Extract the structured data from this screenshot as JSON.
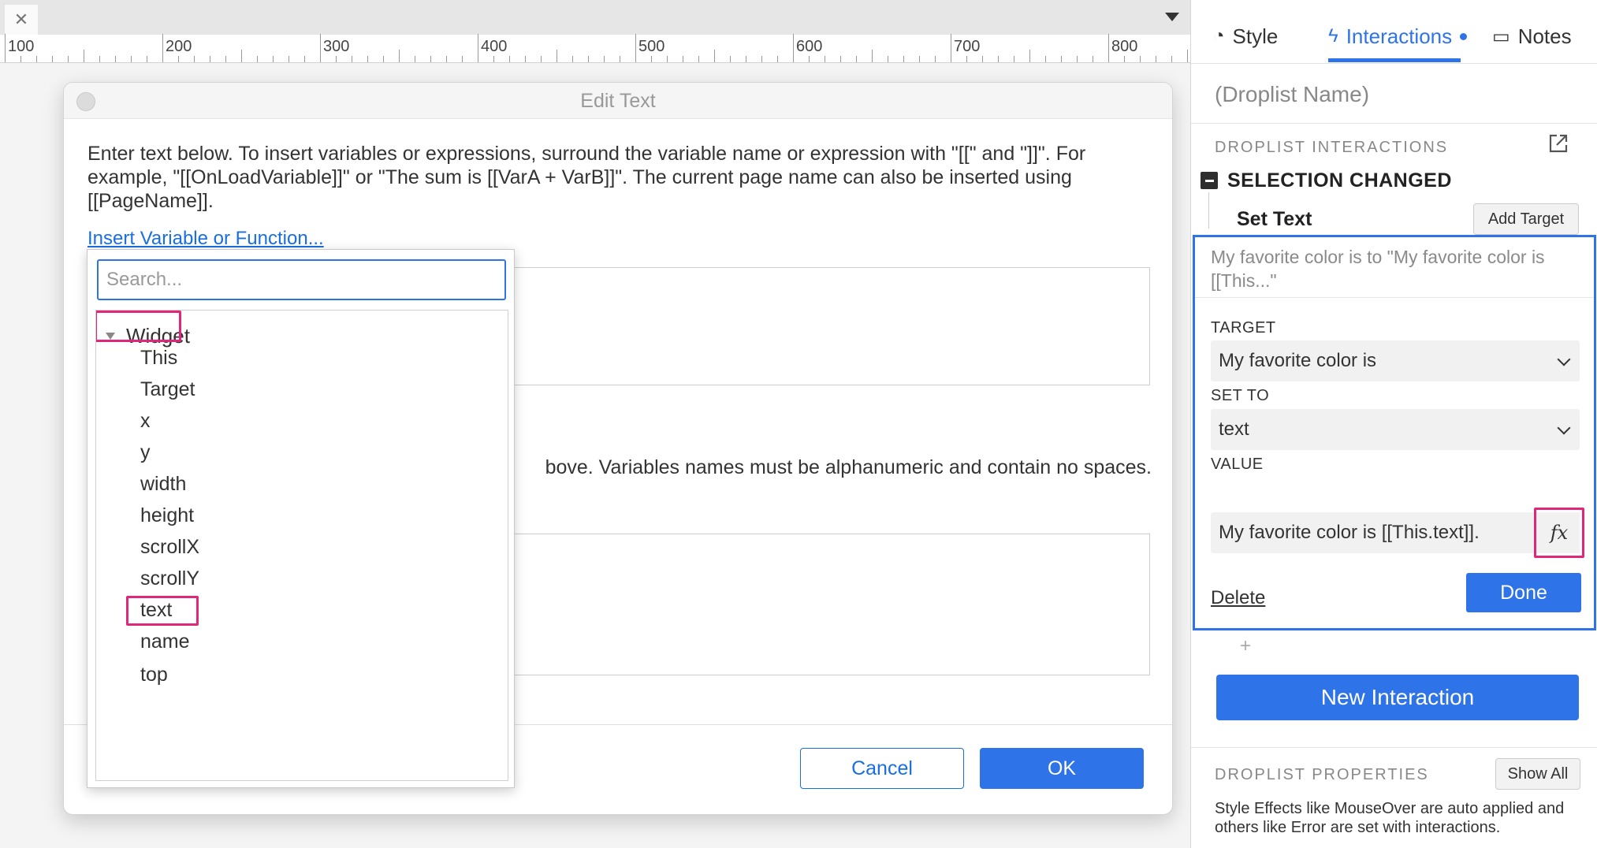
{
  "ruler": {
    "labels": [
      "100",
      "200",
      "300",
      "400",
      "500",
      "600",
      "700",
      "800"
    ]
  },
  "dialog": {
    "title": "Edit Text",
    "instructions": "Enter text below. To insert variables or expressions, surround the variable name or expression with \"[[\" and \"]]\". For example, \"[[OnLoadVariable]]\" or \"The sum is [[VarA + VarB]]\". The current page name can also be inserted using [[PageName]].",
    "insert_link": "Insert Variable or Function...",
    "variables_hint": "bove. Variables names must be alphanumeric and contain no spaces.",
    "cancel_label": "Cancel",
    "ok_label": "OK"
  },
  "popup": {
    "search_placeholder": "Search...",
    "group_label": "Widget",
    "items": [
      "This",
      "Target",
      "x",
      "y",
      "width",
      "height",
      "scrollX",
      "scrollY",
      "text",
      "name",
      "top"
    ],
    "highlighted_item": "text"
  },
  "panel": {
    "tabs": [
      {
        "label": "Style",
        "icon": "style-icon",
        "active": false
      },
      {
        "label": "Interactions",
        "icon": "lightning-icon",
        "active": true
      },
      {
        "label": "Notes",
        "icon": "notes-icon",
        "active": false
      }
    ],
    "widget_name_placeholder": "(Droplist Name)",
    "interactions_header": "DROPLIST INTERACTIONS",
    "event_label": "SELECTION CHANGED",
    "action_label": "Set Text",
    "add_target_label": "Add Target",
    "summary": "My favorite color is to \"My favorite color is [[This...\"",
    "target_label": "TARGET",
    "target_value": "My favorite color is",
    "set_to_label": "SET TO",
    "set_to_value": "text",
    "value_label": "VALUE",
    "value_text": "My favorite color is [[This.text]].",
    "fx_label": "fx",
    "delete_label": "Delete",
    "done_label": "Done",
    "plus_label": "+",
    "new_interaction_label": "New Interaction",
    "properties_header": "DROPLIST PROPERTIES",
    "show_all_label": "Show All",
    "properties_desc": "Style Effects like MouseOver are auto applied and others like Error are set with interactions."
  },
  "colors": {
    "accent": "#2f73e8",
    "highlight": "#e0287a"
  }
}
